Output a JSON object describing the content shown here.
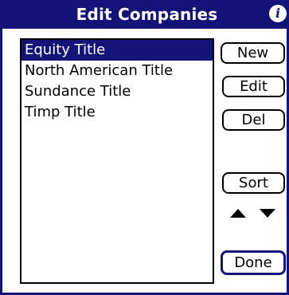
{
  "title_bar": {
    "title": "Edit Companies",
    "info_icon": "info-icon"
  },
  "companies": {
    "selected_index": 0,
    "items": [
      {
        "label": "Equity Title"
      },
      {
        "label": "North American Title"
      },
      {
        "label": "Sundance Title"
      },
      {
        "label": "Timp Title"
      }
    ]
  },
  "buttons": {
    "new_label": "New",
    "edit_label": "Edit",
    "del_label": "Del",
    "sort_label": "Sort",
    "done_label": "Done"
  },
  "arrows": {
    "up_icon": "arrow-up-icon",
    "down_icon": "arrow-down-icon"
  },
  "colors": {
    "accent": "#131378",
    "background": "#ffffff",
    "text": "#000000"
  }
}
